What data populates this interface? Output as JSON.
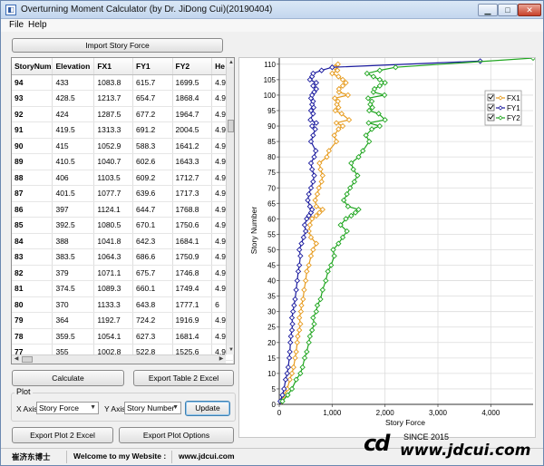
{
  "window": {
    "title": "Overturning Moment Calculator (by Dr. JiDong Cui)(20190404)",
    "controls": {
      "minimize": "▁",
      "maximize": "□",
      "close": "✕"
    }
  },
  "menu": {
    "file": "File",
    "help": "Help"
  },
  "import_button": "Import Story Force",
  "table": {
    "columns": [
      "StoryNum",
      "Elevation",
      "FX1",
      "FY1",
      "FY2",
      "He"
    ],
    "rows": [
      [
        "94",
        "433",
        "1083.8",
        "615.7",
        "1699.5",
        "4.9"
      ],
      [
        "93",
        "428.5",
        "1213.7",
        "654.7",
        "1868.4",
        "4.9"
      ],
      [
        "92",
        "424",
        "1287.5",
        "677.2",
        "1964.7",
        "4.9"
      ],
      [
        "91",
        "419.5",
        "1313.3",
        "691.2",
        "2004.5",
        "4.9"
      ],
      [
        "90",
        "415",
        "1052.9",
        "588.3",
        "1641.2",
        "4.9"
      ],
      [
        "89",
        "410.5",
        "1040.7",
        "602.6",
        "1643.3",
        "4.9"
      ],
      [
        "88",
        "406",
        "1103.5",
        "609.2",
        "1712.7",
        "4.9"
      ],
      [
        "87",
        "401.5",
        "1077.7",
        "639.6",
        "1717.3",
        "4.9"
      ],
      [
        "86",
        "397",
        "1124.1",
        "644.7",
        "1768.8",
        "4.9"
      ],
      [
        "85",
        "392.5",
        "1080.5",
        "670.1",
        "1750.6",
        "4.9"
      ],
      [
        "84",
        "388",
        "1041.8",
        "642.3",
        "1684.1",
        "4.9"
      ],
      [
        "83",
        "383.5",
        "1064.3",
        "686.6",
        "1750.9",
        "4.9"
      ],
      [
        "82",
        "379",
        "1071.1",
        "675.7",
        "1746.8",
        "4.9"
      ],
      [
        "81",
        "374.5",
        "1089.3",
        "660.1",
        "1749.4",
        "4.9"
      ],
      [
        "80",
        "370",
        "1133.3",
        "643.8",
        "1777.1",
        "6"
      ],
      [
        "79",
        "364",
        "1192.7",
        "724.2",
        "1916.9",
        "4.9"
      ],
      [
        "78",
        "359.5",
        "1054.1",
        "627.3",
        "1681.4",
        "4.9"
      ],
      [
        "77",
        "355",
        "1002.8",
        "522.8",
        "1525.6",
        "4.9"
      ],
      [
        "76",
        "350.5",
        "1119.4",
        "685.1",
        "1804.5",
        "4.9"
      ],
      [
        "75",
        "346",
        "1182.5",
        "728",
        "1910.5",
        "4.9"
      ],
      [
        "74",
        "341.5",
        "1171.3",
        "711.2",
        "1882.5",
        "4.9"
      ]
    ],
    "selected": {
      "row": 19,
      "col": 3
    }
  },
  "calculate_button": "Calculate",
  "export_table_button": "Export Table 2 Excel",
  "plot": {
    "legend": "Plot",
    "x_axis_label": "X Axis",
    "x_axis_value": "Story Force",
    "y_axis_label": "Y Axis",
    "y_axis_value": "Story Number",
    "update_button": "Update"
  },
  "export_plot_button": "Export Plot 2 Excel",
  "plot_options_button": "Export Plot Options",
  "status": {
    "name": "崔济东博士",
    "welcome": "Welcome to my Website :",
    "url": "www.jdcui.com"
  },
  "watermark": {
    "logo": "cd",
    "since": "SINCE 2015",
    "site": "www.jdcui.com"
  },
  "colors": {
    "FX1": "#e69a1c",
    "FY1": "#1a1a9e",
    "FY2": "#1ea51e"
  },
  "chart_data": {
    "type": "line",
    "xlabel": "Story Force",
    "ylabel": "Story Number",
    "xlim": [
      0,
      4800
    ],
    "ylim": [
      0,
      112
    ],
    "xticks": [
      0,
      1000,
      2000,
      3000,
      4000
    ],
    "xtick_labels": [
      "0",
      "1,000",
      "2,000",
      "3,000",
      "4,000"
    ],
    "yticks": [
      0,
      5,
      10,
      15,
      20,
      25,
      30,
      35,
      40,
      45,
      50,
      55,
      60,
      65,
      70,
      75,
      80,
      85,
      90,
      95,
      100,
      105,
      110
    ],
    "grid": true,
    "legend_position": "top-right",
    "series": [
      {
        "name": "FX1",
        "color": "#e69a1c",
        "x": [
          40,
          100,
          150,
          200,
          240,
          270,
          300,
          320,
          340,
          350,
          380,
          400,
          380,
          410,
          420,
          450,
          470,
          500,
          520,
          560,
          600,
          640,
          700,
          600,
          560,
          580,
          620,
          700,
          760,
          820,
          700,
          680,
          720,
          750,
          800,
          820,
          780,
          760,
          900,
          940,
          1080,
          1040,
          1120,
          1200,
          1080,
          1320,
          1180,
          1060,
          1120,
          1090,
          1110,
          1050,
          1300,
          1130,
          1130,
          1200,
          1260,
          1200,
          1120,
          1000,
          1100,
          1050,
          1110
        ],
        "y": [
          1,
          3,
          5,
          8,
          10,
          12,
          15,
          17,
          20,
          22,
          24,
          26,
          28,
          30,
          32,
          34,
          37,
          40,
          43,
          45,
          48,
          50,
          52,
          54,
          56,
          58,
          60,
          61,
          62,
          63,
          64,
          66,
          68,
          70,
          72,
          74,
          76,
          78,
          80,
          82,
          85,
          87,
          89,
          90,
          91,
          92,
          94,
          95,
          96,
          97,
          98,
          99,
          100,
          101,
          102,
          103,
          104,
          105,
          106,
          107,
          108,
          109,
          110
        ]
      },
      {
        "name": "FY1",
        "color": "#1a1a9e",
        "x": [
          20,
          60,
          90,
          120,
          150,
          170,
          190,
          200,
          210,
          220,
          240,
          250,
          240,
          260,
          280,
          300,
          320,
          340,
          360,
          380,
          400,
          380,
          420,
          460,
          500,
          480,
          520,
          560,
          600,
          620,
          580,
          540,
          560,
          600,
          640,
          660,
          620,
          600,
          660,
          690,
          600,
          640,
          680,
          620,
          700,
          590,
          640,
          600,
          650,
          620,
          640,
          600,
          620,
          660,
          700,
          640,
          700,
          580,
          620,
          640,
          800,
          1000,
          3800
        ],
        "y": [
          1,
          3,
          5,
          8,
          10,
          12,
          15,
          17,
          20,
          22,
          24,
          26,
          28,
          30,
          32,
          34,
          37,
          40,
          43,
          45,
          48,
          50,
          52,
          54,
          56,
          58,
          60,
          61,
          62,
          63,
          64,
          66,
          68,
          70,
          72,
          74,
          76,
          78,
          80,
          82,
          85,
          87,
          89,
          90,
          91,
          92,
          94,
          95,
          96,
          97,
          98,
          99,
          100,
          101,
          102,
          103,
          104,
          105,
          106,
          107,
          108,
          109,
          111
        ]
      },
      {
        "name": "FY2",
        "color": "#1ea51e",
        "x": [
          60,
          160,
          240,
          320,
          400,
          440,
          480,
          520,
          560,
          580,
          620,
          660,
          640,
          700,
          720,
          780,
          820,
          880,
          920,
          980,
          1040,
          1020,
          1120,
          1200,
          1280,
          1160,
          1260,
          1360,
          1440,
          1500,
          1300,
          1220,
          1280,
          1340,
          1420,
          1480,
          1400,
          1360,
          1500,
          1580,
          1700,
          1640,
          1750,
          1900,
          1690,
          2000,
          1880,
          1700,
          1760,
          1720,
          1750,
          1680,
          1990,
          1780,
          1800,
          1900,
          2000,
          1900,
          1780,
          1660,
          1900,
          2200,
          4800
        ],
        "y": [
          1,
          3,
          5,
          8,
          10,
          12,
          15,
          17,
          20,
          22,
          24,
          26,
          28,
          30,
          32,
          34,
          37,
          40,
          43,
          45,
          48,
          50,
          52,
          54,
          56,
          58,
          60,
          61,
          62,
          63,
          64,
          66,
          68,
          70,
          72,
          74,
          76,
          78,
          80,
          82,
          85,
          87,
          89,
          90,
          91,
          92,
          94,
          95,
          96,
          97,
          98,
          99,
          100,
          101,
          102,
          103,
          104,
          105,
          106,
          107,
          108,
          109,
          112
        ]
      }
    ]
  }
}
